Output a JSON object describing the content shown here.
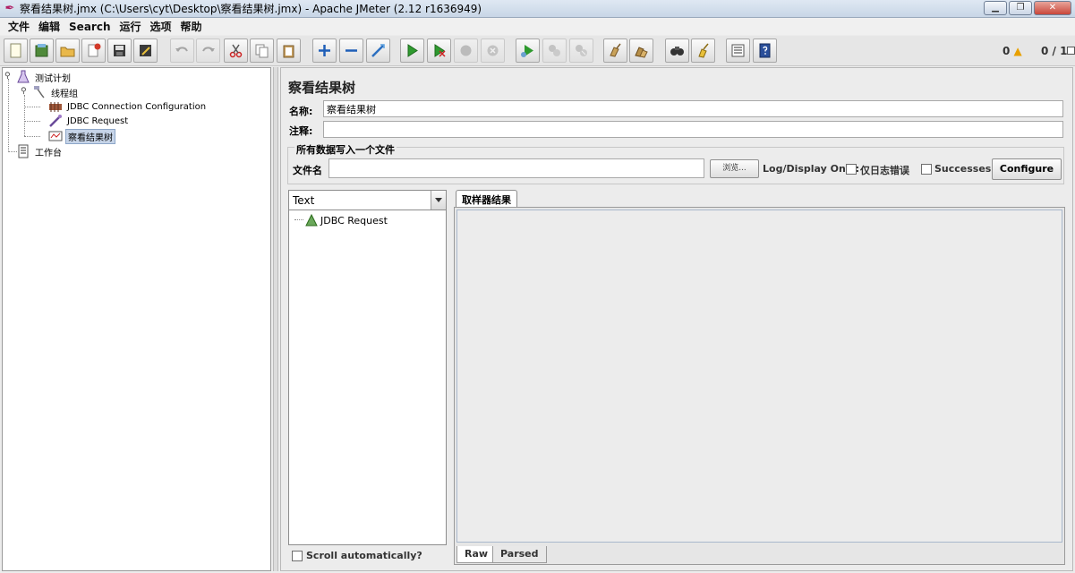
{
  "window": {
    "title": "察看结果树.jmx (C:\\Users\\cyt\\Desktop\\察看结果树.jmx) - Apache JMeter (2.12 r1636949)",
    "minimize_label": "▁",
    "restore_label": "❐",
    "close_label": "✕"
  },
  "menu": [
    "文件",
    "编辑",
    "Search",
    "运行",
    "选项",
    "帮助"
  ],
  "toolbar": {
    "status_warnings": "0",
    "status_threads": "0 / 1"
  },
  "tree": {
    "items": [
      {
        "label": "测试计划",
        "icon": "test-plan-icon"
      },
      {
        "label": "线程组",
        "icon": "thread-group-icon"
      },
      {
        "label": "JDBC Connection Configuration",
        "icon": "config-element-icon"
      },
      {
        "label": "JDBC Request",
        "icon": "sampler-icon"
      },
      {
        "label": "察看结果树",
        "icon": "listener-icon",
        "selected": true
      },
      {
        "label": "工作台",
        "icon": "workbench-icon"
      }
    ]
  },
  "panel": {
    "title": "察看结果树",
    "name_label": "名称:",
    "name_value": "察看结果树",
    "comment_label": "注释:",
    "comment_value": "",
    "file_group_title": "所有数据写入一个文件",
    "file_label": "文件名",
    "file_value": "",
    "browse_label": "浏览...",
    "log_display_label": "Log/Display Only:",
    "errors_only_label": "仅日志错误",
    "successes_label": "Successes",
    "configure_label": "Configure"
  },
  "results": {
    "renderer": "Text",
    "items": [
      "JDBC Request"
    ],
    "scroll_auto_label": "Scroll automatically?"
  },
  "sampler_tab": {
    "label": "取样器结果",
    "subtabs": [
      "Raw",
      "Parsed"
    ]
  },
  "colors": {
    "accent_green": "#2e9a2e",
    "selection": "#c6d4e8"
  }
}
